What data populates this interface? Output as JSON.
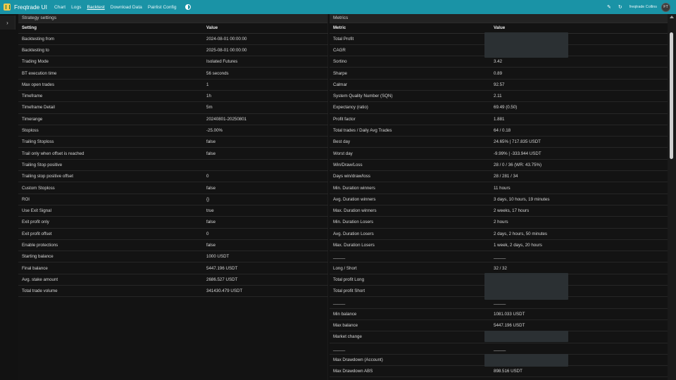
{
  "navbar": {
    "brand": "Freqtrade UI",
    "links": [
      "Chart",
      "Logs",
      "Backtest",
      "Download Data",
      "Pairlist Config"
    ],
    "active_link": "Backtest",
    "bot_name": "freqtrade Collins",
    "avatar": "FT"
  },
  "strategy": {
    "title": "Strategy settings",
    "headers": [
      "Setting",
      "Value"
    ],
    "rows": [
      [
        "Backtesting from",
        "2024-08-01 00:00:00"
      ],
      [
        "Backtesting to",
        "2025-08-01 00:00:00"
      ],
      [
        "Trading Mode",
        "Isolated Futures"
      ],
      [
        "BT execution time",
        "56 seconds"
      ],
      [
        "Max open trades",
        "1"
      ],
      [
        "Timeframe",
        "1h"
      ],
      [
        "Timeframe Detail",
        "5m"
      ],
      [
        "Timerange",
        "20240801-20250801"
      ],
      [
        "Stoploss",
        "-25.00%"
      ],
      [
        "Trailing Stoploss",
        "false"
      ],
      [
        "Trail only when offset is reached",
        "false"
      ],
      [
        "Trailing Stop positive",
        ""
      ],
      [
        "Trailing stop positive offset",
        "0"
      ],
      [
        "Custom Stoploss",
        "false"
      ],
      [
        "ROI",
        "{}"
      ],
      [
        "Use Exit Signal",
        "true"
      ],
      [
        "Exit profit only",
        "false"
      ],
      [
        "Exit profit offset",
        "0"
      ],
      [
        "Enable protections",
        "false"
      ],
      [
        "Starting balance",
        "1000 USDT"
      ],
      [
        "Final balance",
        "5447.196 USDT"
      ],
      [
        "Avg. stake amount",
        "2686.527 USDT"
      ],
      [
        "Total trade volume",
        "341430.479 USDT"
      ]
    ]
  },
  "metrics": {
    "title": "Metrics",
    "headers": [
      "Metric",
      "Value"
    ],
    "rows": [
      [
        "Total Profit",
        ""
      ],
      [
        "CAGR",
        ""
      ],
      [
        "Sortino",
        "3.42"
      ],
      [
        "Sharpe",
        "0.89"
      ],
      [
        "Calmar",
        "92.57"
      ],
      [
        "System Quality Number (SQN)",
        "2.11"
      ],
      [
        "Expectancy (ratio)",
        "69.49 (0.50)"
      ],
      [
        "Profit factor",
        "1.881"
      ],
      [
        "Total trades / Daily Avg Trades",
        "64 / 0.18"
      ],
      [
        "Best day",
        "24.65% | 717.835 USDT"
      ],
      [
        "Worst day",
        "-9.99% | -333.944 USDT"
      ],
      [
        "Win/Draw/Loss",
        "28 / 0 / 36 (WR: 43.75%)"
      ],
      [
        "Days win/draw/loss",
        "28 / 281 / 34"
      ],
      [
        "Min. Duration winners",
        "11 hours"
      ],
      [
        "Avg. Duration winners",
        "3 days, 10 hours, 19 minutes"
      ],
      [
        "Max. Duration winners",
        "2 weeks, 17 hours"
      ],
      [
        "Min. Duration Losers",
        "2 hours"
      ],
      [
        "Avg. Duration Losers",
        "2 days, 2 hours, 50 minutes"
      ],
      [
        "Max. Duration Losers",
        "1 week, 2 days, 20 hours"
      ],
      [
        "_____",
        "_____"
      ],
      [
        "Long / Short",
        "32 / 32"
      ],
      [
        "Total profit Long",
        ""
      ],
      [
        "Total profit Short",
        ""
      ],
      [
        "_____",
        "_____"
      ],
      [
        "Min balance",
        "1081.033 USDT"
      ],
      [
        "Max balance",
        "5447.196 USDT"
      ],
      [
        "Market change",
        ""
      ],
      [
        "_____",
        "_____"
      ],
      [
        "Max Drawdown (Account)",
        ""
      ],
      [
        "Max Drawdown ABS",
        "898.516 USDT"
      ]
    ]
  }
}
